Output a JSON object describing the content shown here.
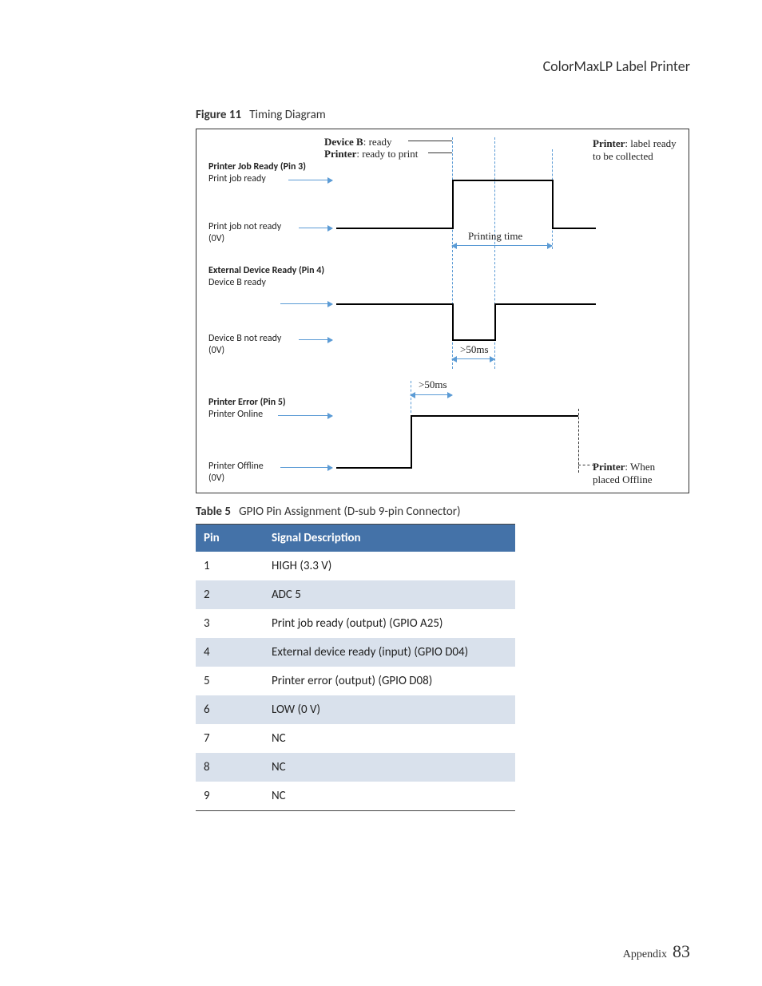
{
  "header": {
    "title": "ColorMaxLP Label Printer"
  },
  "figure": {
    "label": "Figure 11",
    "title": "Timing Diagram",
    "top_labels": {
      "device_b": "Device B",
      "device_b_state": ": ready",
      "printer": "Printer",
      "printer_state": ": ready to print"
    },
    "right_labels": {
      "printer_top": "Printer",
      "printer_top_rest": ": label ready to be collected",
      "printer_bottom": "Printer",
      "printer_bottom_rest": ": When placed Offline"
    },
    "signals": {
      "s1_title": "Printer Job Ready (Pin 3)",
      "s1_hi": "Print job ready",
      "s1_lo_a": "Print job not ready",
      "s1_lo_b": "(0V)",
      "s2_title": "External Device Ready (Pin 4)",
      "s2_hi": "Device B ready",
      "s2_lo_a": "Device B not ready",
      "s2_lo_b": "(0V)",
      "s3_title": "Printer Error (Pin 5)",
      "s3_hi": "Printer Online",
      "s3_lo_a": "Printer Offline",
      "s3_lo_b": "(0V)"
    },
    "annotations": {
      "printing_time": "Printing time",
      "gt50_a": ">50ms",
      "gt50_b": ">50ms"
    }
  },
  "table": {
    "label": "Table 5",
    "title": "GPIO Pin Assignment (D-sub 9-pin Connector)",
    "headers": {
      "pin": "Pin",
      "desc": "Signal Description"
    },
    "rows": [
      {
        "pin": "1",
        "desc": "HIGH (3.3 V)"
      },
      {
        "pin": "2",
        "desc": "ADC 5"
      },
      {
        "pin": "3",
        "desc": "Print job ready (output) (GPIO A25)"
      },
      {
        "pin": "4",
        "desc": "External device ready (input) (GPIO D04)"
      },
      {
        "pin": "5",
        "desc": "Printer error (output) (GPIO D08)"
      },
      {
        "pin": "6",
        "desc": "LOW (0 V)"
      },
      {
        "pin": "7",
        "desc": "NC"
      },
      {
        "pin": "8",
        "desc": "NC"
      },
      {
        "pin": "9",
        "desc": "NC"
      }
    ]
  },
  "footer": {
    "section": "Appendix",
    "page": "83"
  }
}
